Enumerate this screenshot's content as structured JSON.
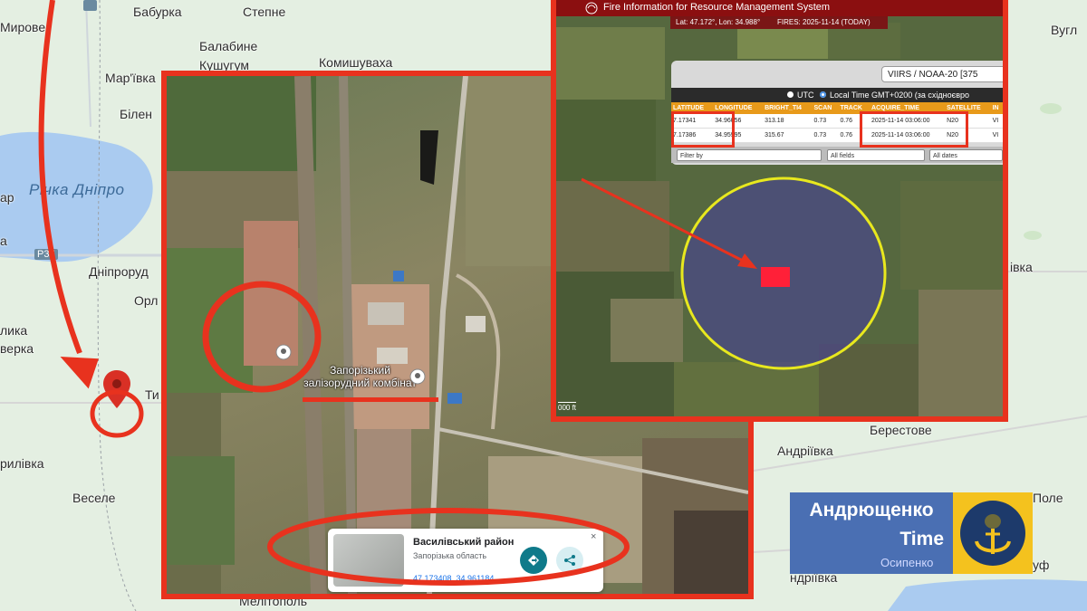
{
  "base_map": {
    "labels": {
      "babyrka": "Бабурка",
      "stepne": "Степне",
      "mirove": "Мирове",
      "balabyne": "Балабине",
      "kushuhum": "Кушугум",
      "komyshuvakha": "Комишуваха",
      "marivka": "Мар'ївка",
      "bilen": "Білен",
      "vuhl": "Вугл",
      "dniprorud": "Дніпроруд",
      "orl": "Орл",
      "lyka": "лика",
      "verka": "верка",
      "ty": "Ти",
      "rylivka": "рилівка",
      "vesele": "Веселе",
      "andriivka": "Андріївка",
      "berestove": "Берестове",
      "vka": "вка",
      "pole": "Поле",
      "osypenko": "Осипенко",
      "andriivka2": "ндріївка",
      "uf": "уф",
      "melitopol": "Мелітополь",
      "ar": "ар",
      "a": "а",
      "ivka": "івка"
    },
    "water_label": "Річка Дніпро",
    "road_shields": [
      "P37",
      "P37"
    ]
  },
  "satellite": {
    "plant_label": "Запорізький залізорудний комбінат",
    "info_card": {
      "title": "Василівський район",
      "subtitle": "Запорізька область",
      "coords": "47.173408, 34.961184",
      "close": "×"
    }
  },
  "firms": {
    "header_title": "Fire Information for Resource Management System",
    "latlon": "Lat: 47.172°, Lon: 34.988°",
    "fires_date": "FIRES: 2025-11-14 (TODAY)",
    "sensor_title": "VIIRS / NOAA-20 [375",
    "tz_utc": "UTC",
    "tz_local": "Local Time GMT+0200 (за східноєвро",
    "columns": [
      "LATITUDE",
      "LONGITUDE",
      "BRIGHT_TI4",
      "SCAN",
      "TRACK",
      "ACQUIRE_TIME",
      "SATELLITE",
      "IN"
    ],
    "rows": [
      [
        "7.17341",
        "34.96056",
        "313.18",
        "0.73",
        "0.76",
        "2025-11-14 03:06:00",
        "N20",
        "VI"
      ],
      [
        "7.17386",
        "34.95995",
        "315.67",
        "0.73",
        "0.76",
        "2025-11-14 03:06:00",
        "N20",
        "VI"
      ]
    ],
    "filter_placeholder": "Filter by",
    "all_fields": "All fields",
    "all_dates": "All dates",
    "scale": "000 ft"
  },
  "brand": {
    "name_line1": "Андрющенко",
    "name_line2": "Time"
  },
  "colors": {
    "annotation_red": "#e8321e",
    "brand_blue": "#4a6fb3",
    "brand_yellow": "#f4c21e",
    "firms_red": "#8b0f10",
    "table_header": "#e89a1a",
    "circle_yellow": "#e8e81e"
  }
}
